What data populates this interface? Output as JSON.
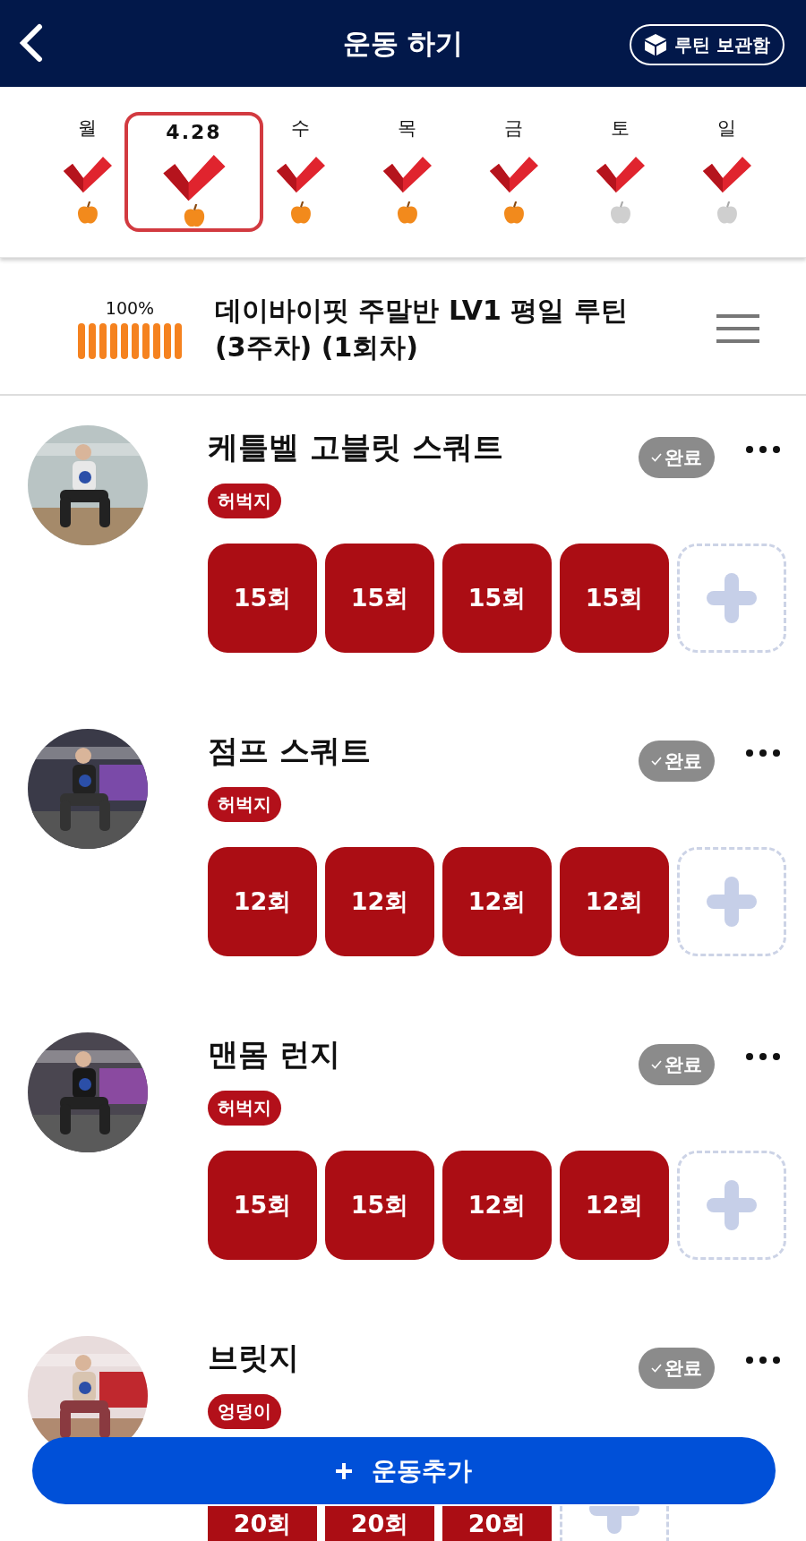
{
  "header": {
    "title": "운동 하기",
    "routine_button": "루틴 보관함"
  },
  "week": [
    {
      "label": "월",
      "selected": false,
      "apple_done": true
    },
    {
      "label": "4.28",
      "selected": true,
      "apple_done": true
    },
    {
      "label": "수",
      "selected": false,
      "apple_done": true
    },
    {
      "label": "목",
      "selected": false,
      "apple_done": true
    },
    {
      "label": "금",
      "selected": false,
      "apple_done": true
    },
    {
      "label": "토",
      "selected": false,
      "apple_done": false
    },
    {
      "label": "일",
      "selected": false,
      "apple_done": false
    }
  ],
  "routine": {
    "progress_text": "100%",
    "level": 1,
    "title": "데이바이핏 주말반 LV1 평일 루틴 (3주차) (1회차)"
  },
  "exercises": [
    {
      "name": "케틀벨 고블릿 스쿼트",
      "tag": "허벅지",
      "status": "완료",
      "sets": [
        "15회",
        "15회",
        "15회",
        "15회"
      ]
    },
    {
      "name": "점프 스쿼트",
      "tag": "허벅지",
      "status": "완료",
      "sets": [
        "12회",
        "12회",
        "12회",
        "12회"
      ]
    },
    {
      "name": "맨몸 런지",
      "tag": "허벅지",
      "status": "완료",
      "sets": [
        "15회",
        "15회",
        "12회",
        "12회"
      ]
    },
    {
      "name": "브릿지",
      "tag": "엉덩이",
      "status": "완료",
      "sets": [
        "20회",
        "20회",
        "20회"
      ]
    }
  ],
  "add_button": "운동추가"
}
